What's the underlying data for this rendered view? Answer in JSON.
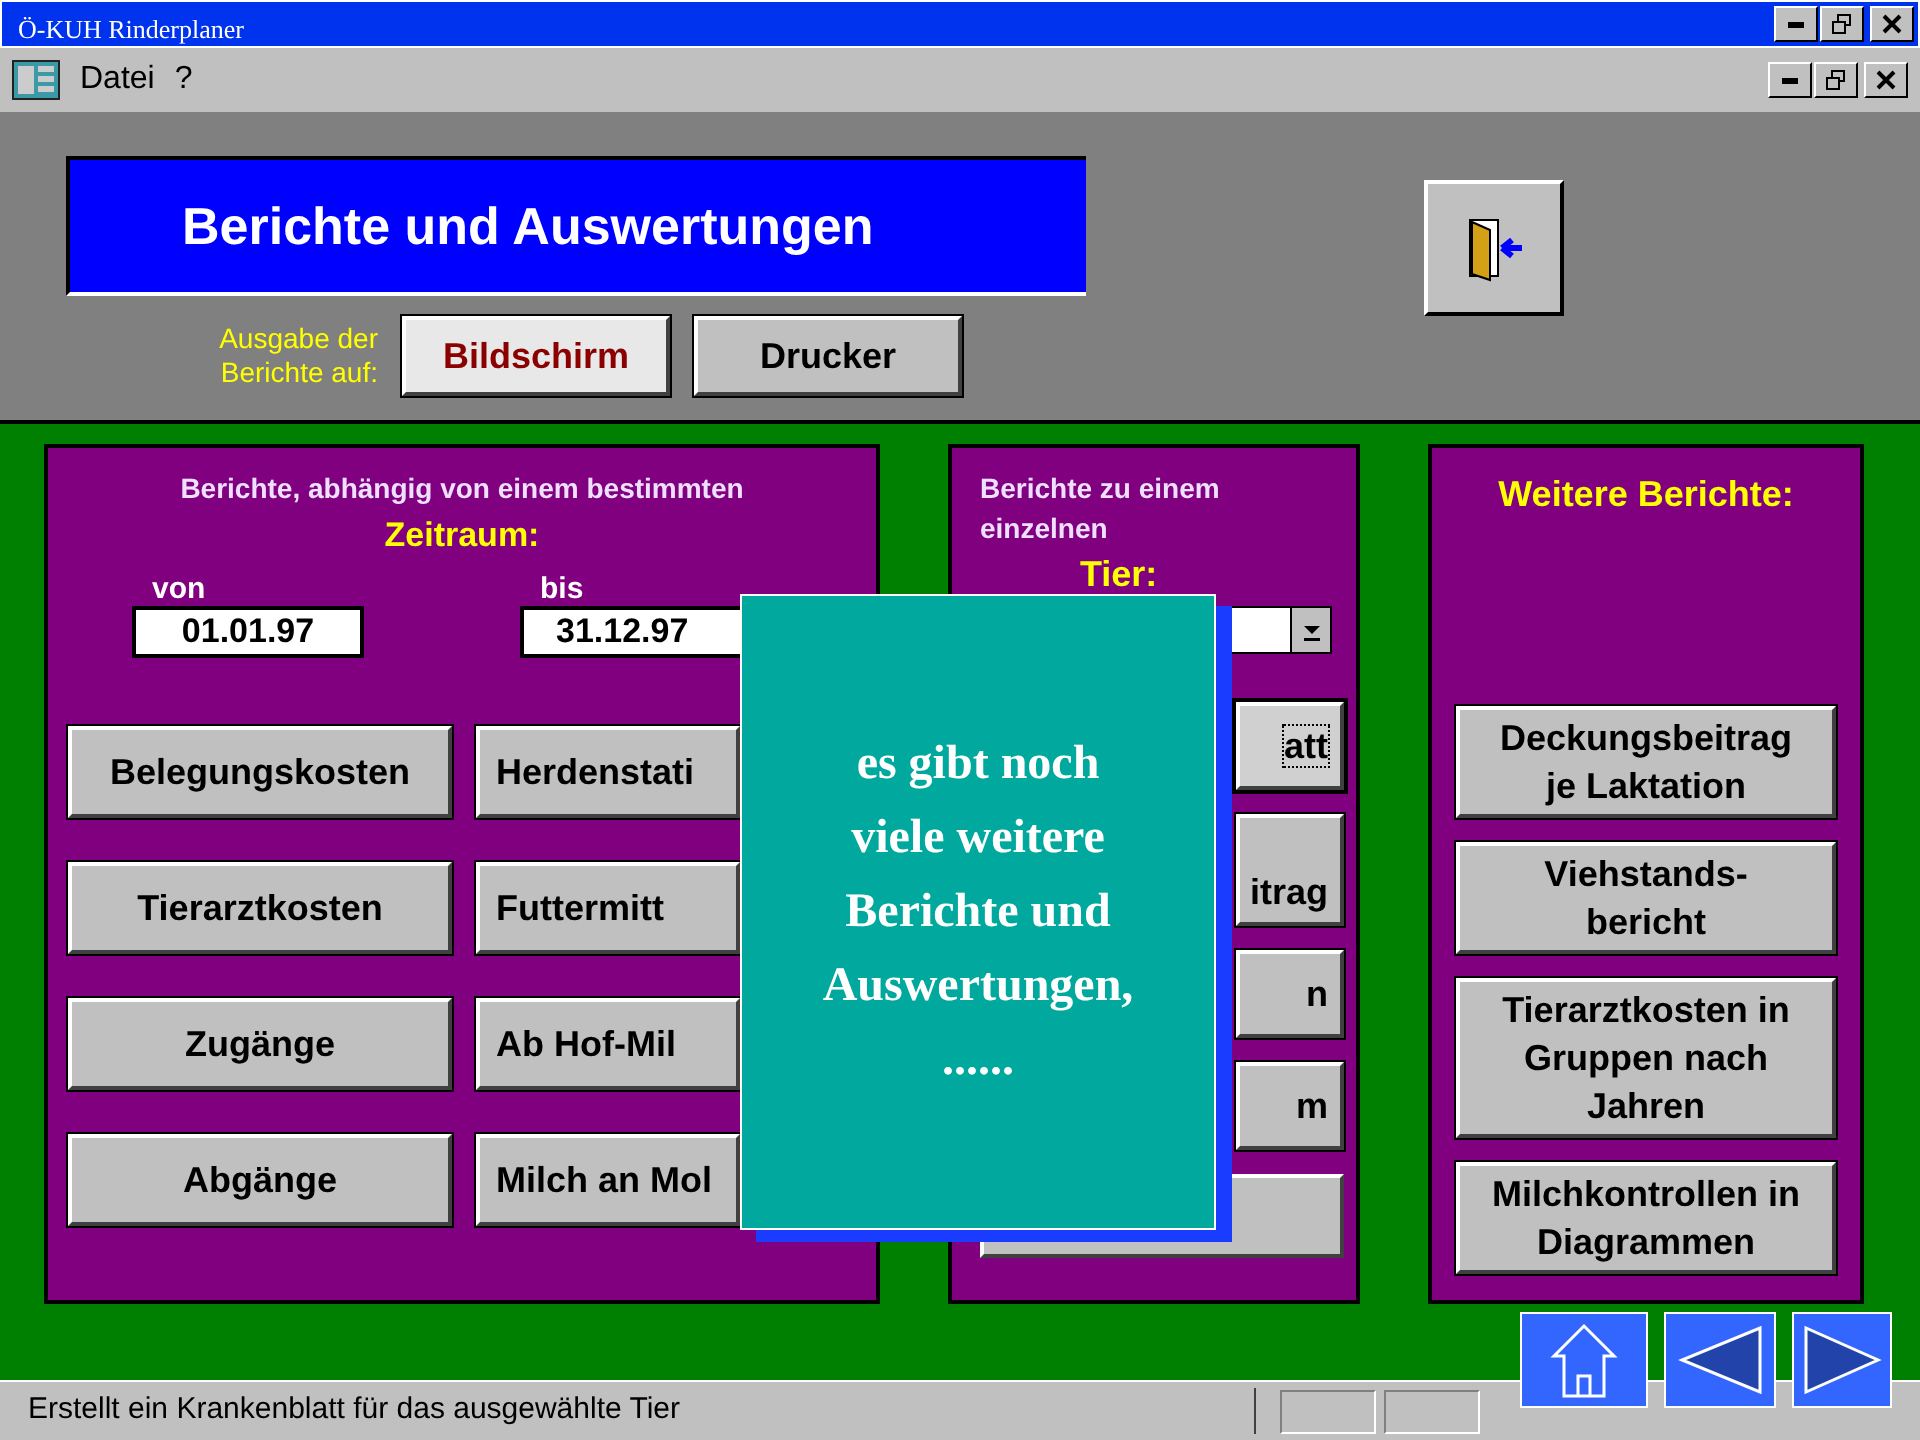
{
  "window": {
    "title": "Ö-KUH Rinderplaner"
  },
  "menu": [
    {
      "label": "Datei"
    },
    {
      "label": "?"
    }
  ],
  "header": {
    "title": "Berichte und Auswertungen",
    "output_label": "Ausgabe der Berichte auf:",
    "output_options": [
      {
        "label": "Bildschirm",
        "selected": true
      },
      {
        "label": "Drucker",
        "selected": false
      }
    ]
  },
  "period_panel": {
    "heading": "Berichte, abhängig von einem bestimmten",
    "highlight": "Zeitraum:",
    "from_label": "von",
    "from_value": "01.01.97",
    "to_label": "bis",
    "to_value": "31.12.97",
    "buttons": [
      [
        "Belegungskosten",
        "Herdenstati"
      ],
      [
        "Tierarztkosten",
        "Futtermitt"
      ],
      [
        "Zugänge",
        "Ab Hof-Mil"
      ],
      [
        "Abgänge",
        "Milch an Mol"
      ]
    ]
  },
  "animal_panel": {
    "heading": "Berichte zu einem einzelnen",
    "highlight": "Tier:",
    "buttons": [
      {
        "label": "att",
        "focused": true
      },
      {
        "label": "itrag",
        "focused": false
      },
      {
        "label": "n",
        "focused": false
      },
      {
        "label": "m",
        "focused": false
      }
    ]
  },
  "more_panel": {
    "heading": "Weitere Berichte:",
    "buttons": [
      "Deckungsbeitrag je Laktation",
      "Viehstands-bericht",
      "Tierarztkosten in Gruppen nach Jahren",
      "Milchkontrollen in Diagrammen"
    ]
  },
  "callout": {
    "text": "es gibt noch viele weitere Berichte und Auswertungen, ......"
  },
  "status_bar": {
    "text": "Erstellt ein Krankenblatt für das ausgewählte Tier"
  }
}
